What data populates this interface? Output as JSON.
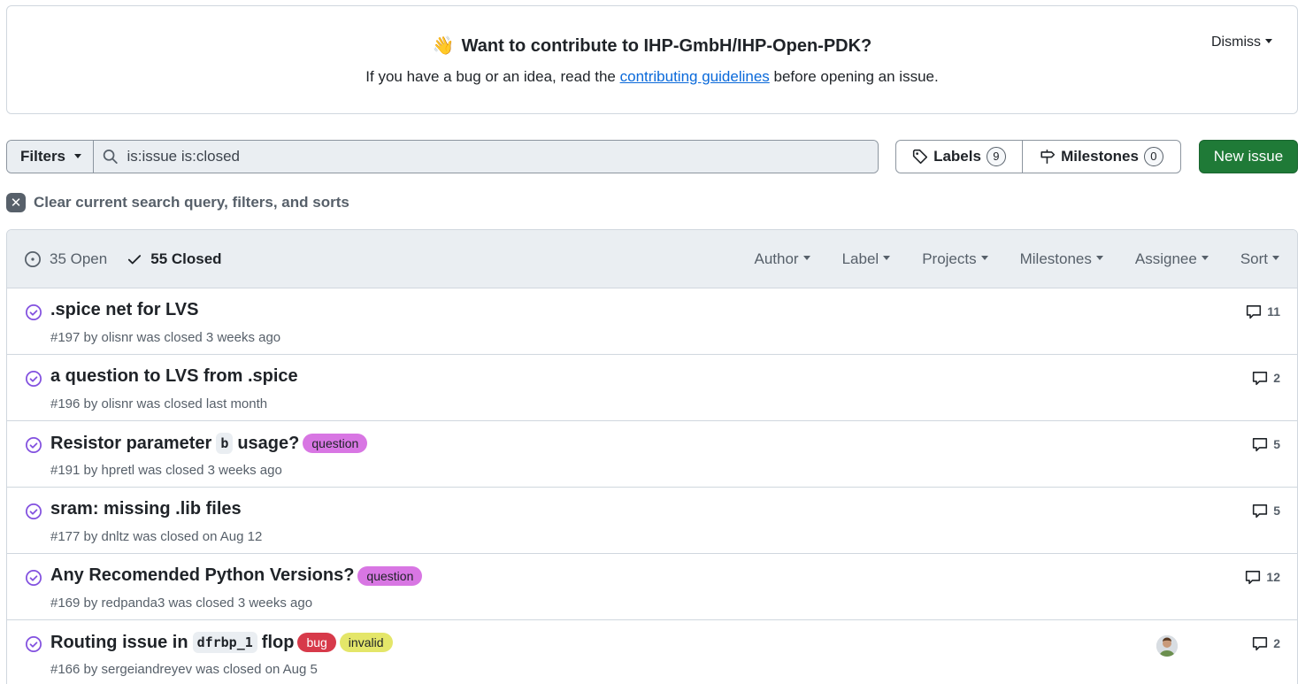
{
  "banner": {
    "emoji": "👋",
    "title": "Want to contribute to IHP-GmbH/IHP-Open-PDK?",
    "text_before": "If you have a bug or an idea, read the ",
    "link": "contributing guidelines",
    "text_after": " before opening an issue.",
    "dismiss": "Dismiss"
  },
  "toolbar": {
    "filters": "Filters",
    "search_value": "is:issue is:closed",
    "labels": "Labels",
    "labels_count": "9",
    "milestones": "Milestones",
    "milestones_count": "0",
    "new_issue": "New issue"
  },
  "clear": "Clear current search query, filters, and sorts",
  "header": {
    "open": "35 Open",
    "closed": "55 Closed",
    "filters": [
      "Author",
      "Label",
      "Projects",
      "Milestones",
      "Assignee",
      "Sort"
    ]
  },
  "issues": [
    {
      "title": ".spice net for LVS",
      "meta": "#197 by olisnr was closed 3 weeks ago",
      "comments": "11"
    },
    {
      "title": "a question to LVS from .spice",
      "meta": "#196 by olisnr was closed last month",
      "comments": "2"
    },
    {
      "title_a": "Resistor parameter",
      "code": "b",
      "title_b": "usage?",
      "label": "question",
      "meta": "#191 by hpretl was closed 3 weeks ago",
      "comments": "5"
    },
    {
      "title": "sram: missing .lib files",
      "meta": "#177 by dnltz was closed on Aug 12",
      "comments": "5"
    },
    {
      "title": "Any Recomended Python Versions?",
      "label": "question",
      "meta": "#169 by redpanda3 was closed 3 weeks ago",
      "comments": "12"
    },
    {
      "title_a": "Routing issue in",
      "code": "dfrbp_1",
      "title_b": "flop",
      "label1": "bug",
      "label2": "invalid",
      "meta": "#166 by sergeiandreyev was closed on Aug 5",
      "comments": "2"
    }
  ],
  "colors": {
    "accent": "#0969da",
    "closed": "#8250df",
    "new_issue_bg": "#1f7a37"
  }
}
